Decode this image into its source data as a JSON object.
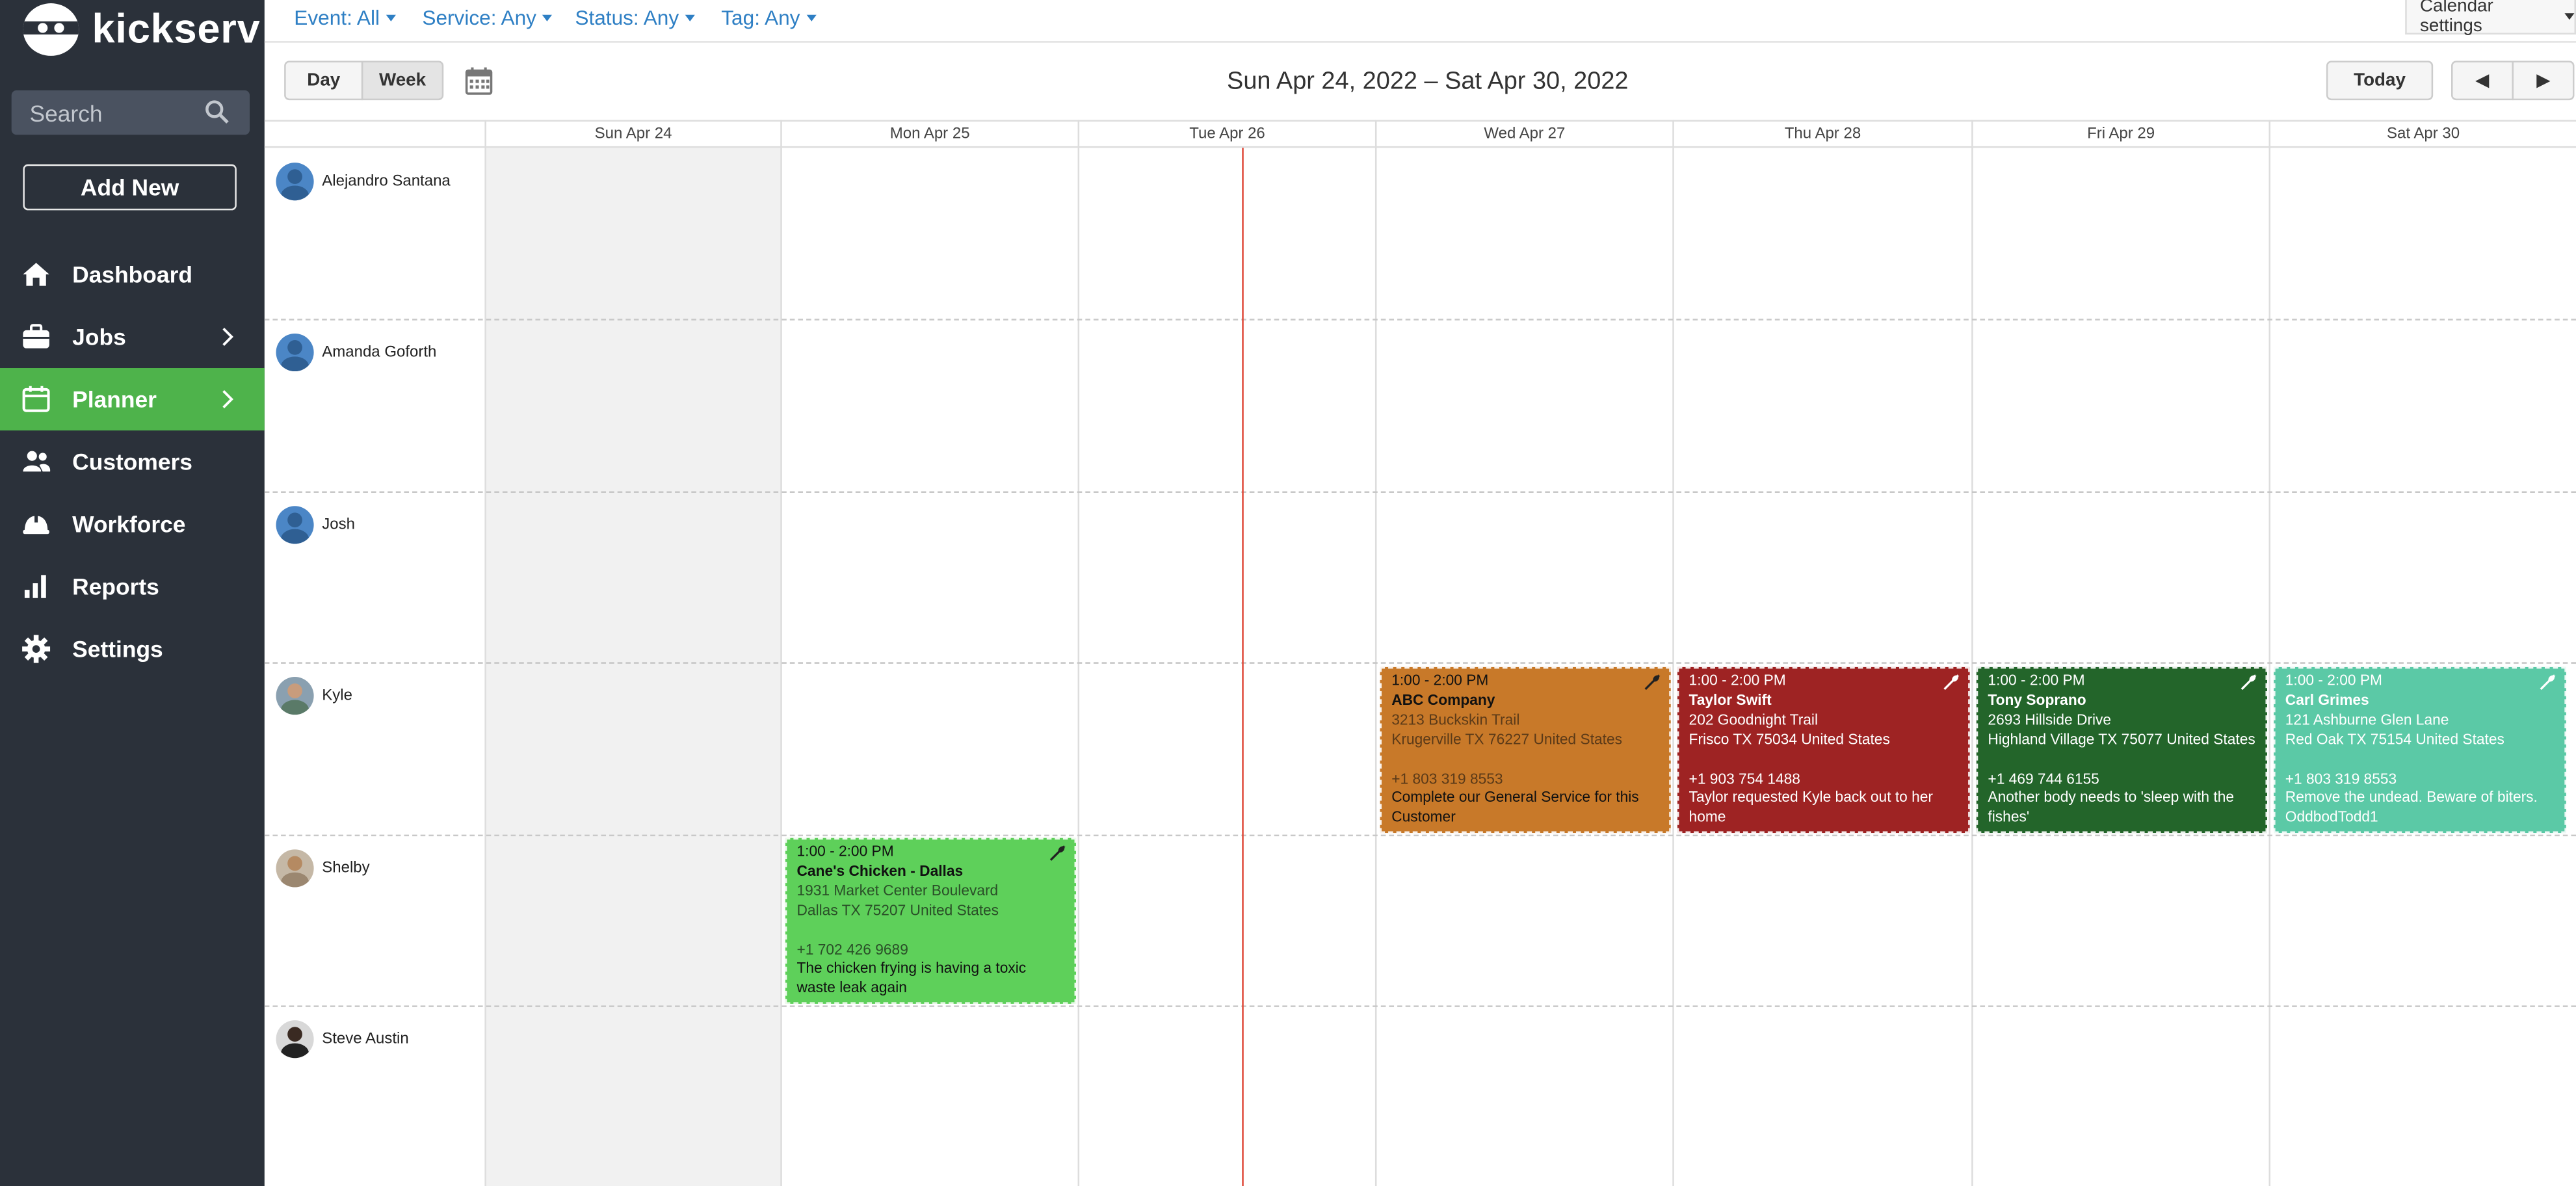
{
  "app": {
    "name": "kickserv"
  },
  "search": {
    "placeholder": "Search"
  },
  "add_new": "Add New",
  "nav": [
    {
      "label": "Dashboard",
      "icon": "home-icon",
      "chevron": false,
      "active": false
    },
    {
      "label": "Jobs",
      "icon": "briefcase-icon",
      "chevron": true,
      "active": false
    },
    {
      "label": "Planner",
      "icon": "calendar-icon",
      "chevron": true,
      "active": true
    },
    {
      "label": "Customers",
      "icon": "users-icon",
      "chevron": false,
      "active": false
    },
    {
      "label": "Workforce",
      "icon": "hardhat-icon",
      "chevron": false,
      "active": false
    },
    {
      "label": "Reports",
      "icon": "bar-chart-icon",
      "chevron": false,
      "active": false
    },
    {
      "label": "Settings",
      "icon": "gear-icon",
      "chevron": false,
      "active": false
    }
  ],
  "filters": {
    "event": "Event: All",
    "service": "Service: Any",
    "status": "Status: Any",
    "tag": "Tag: Any"
  },
  "calendar_settings": "Calendar settings",
  "toolbar": {
    "day": "Day",
    "week": "Week",
    "active_view": "Week",
    "today": "Today",
    "prev": "◀",
    "next": "▶"
  },
  "range_title": "Sun Apr 24, 2022 – Sat Apr 30, 2022",
  "days": [
    "Sun Apr 24",
    "Mon Apr 25",
    "Tue Apr 26",
    "Wed Apr 27",
    "Thu Apr 28",
    "Fri Apr 29",
    "Sat Apr 30"
  ],
  "technicians": [
    {
      "name": "Alejandro Santana",
      "avatar": "default"
    },
    {
      "name": "Amanda Goforth",
      "avatar": "default"
    },
    {
      "name": "Josh",
      "avatar": "default"
    },
    {
      "name": "Kyle",
      "avatar": "photo"
    },
    {
      "name": "Shelby",
      "avatar": "photo"
    },
    {
      "name": "Steve Austin",
      "avatar": "photo"
    }
  ],
  "events": [
    {
      "time": "1:00 - 2:00 PM",
      "customer": "ABC Company",
      "address1": "3213 Buckskin Trail",
      "address2": "Krugerville TX 76227 United States",
      "phone": "+1 803 319 8553",
      "note": "Complete our General Service for this Customer",
      "color": "#c87929",
      "technician": "Kyle",
      "day": "Wed Apr 27"
    },
    {
      "time": "1:00 - 2:00 PM",
      "customer": "Taylor Swift",
      "address1": "202 Goodnight Trail",
      "address2": "Frisco TX 75034 United States",
      "phone": "+1 903 754 1488",
      "note": "Taylor requested Kyle back out to her home",
      "color": "#9e2323",
      "technician": "Kyle",
      "day": "Thu Apr 28"
    },
    {
      "time": "1:00 - 2:00 PM",
      "customer": "Tony Soprano",
      "address1": "2693 Hillside Drive",
      "address2": "Highland Village TX 75077 United States",
      "phone": "+1 469 744 6155",
      "note": "Another body needs to 'sleep with the fishes'",
      "color": "#23652a",
      "technician": "Kyle",
      "day": "Fri Apr 29"
    },
    {
      "time": "1:00 - 2:00 PM",
      "customer": "Carl Grimes",
      "address1": "121 Ashburne Glen Lane",
      "address2": "Red Oak TX 75154 United States",
      "phone": "+1 803 319 8553",
      "note": "Remove the undead. Beware of biters. OddbodTodd1",
      "color": "#5bc9a6",
      "technician": "Kyle",
      "day": "Sat Apr 30"
    },
    {
      "time": "1:00 - 2:00 PM",
      "customer": "Cane's Chicken - Dallas",
      "address1": "1931 Market Center Boulevard",
      "address2": "Dallas TX 75207 United States",
      "phone": "+1 702 426 9689",
      "note": "The chicken frying is having a toxic waste leak again",
      "color": "#5ed05a",
      "technician": "Shelby",
      "day": "Mon Apr 25"
    }
  ]
}
